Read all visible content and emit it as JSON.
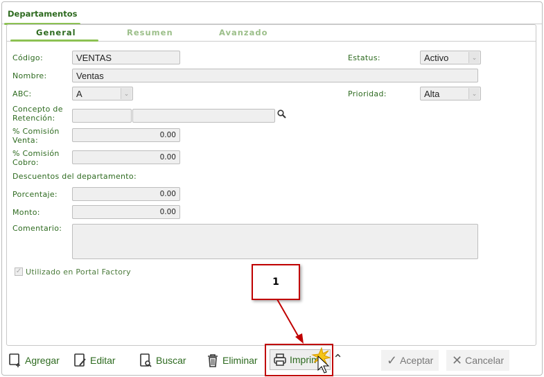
{
  "window": {
    "title": "Departamentos"
  },
  "tabs": [
    {
      "label": "General",
      "active": true
    },
    {
      "label": "Resumen"
    },
    {
      "label": "Avanzado"
    }
  ],
  "form": {
    "codigo": {
      "label": "Código:",
      "value": "VENTAS"
    },
    "estatus": {
      "label": "Estatus:",
      "value": "Activo"
    },
    "nombre": {
      "label": "Nombre:",
      "value": "Ventas"
    },
    "abc": {
      "label": "ABC:",
      "value": "A"
    },
    "prioridad": {
      "label": "Prioridad:",
      "value": "Alta"
    },
    "concepto": {
      "label1": "Concepto de",
      "label2": "Retención:",
      "value1": "",
      "value2": ""
    },
    "comision_venta": {
      "label1": "% Comisión",
      "label2": "Venta:",
      "value": "0.00"
    },
    "comision_cobro": {
      "label1": "% Comisión",
      "label2": "Cobro:",
      "value": "0.00"
    },
    "descuentos_heading": "Descuentos del departamento:",
    "porcentaje": {
      "label": "Porcentaje:",
      "value": "0.00"
    },
    "monto": {
      "label": "Monto:",
      "value": "0.00"
    },
    "comentario": {
      "label": "Comentario:",
      "value": ""
    },
    "portal": {
      "label": "Utilizado en Portal Factory",
      "checked": true
    }
  },
  "toolbar": {
    "agregar": "Agregar",
    "editar": "Editar",
    "buscar": "Buscar",
    "eliminar": "Eliminar",
    "imprimir": "Imprimir",
    "aceptar": "Aceptar",
    "cancelar": "Cancelar"
  },
  "callout": {
    "number": "1"
  },
  "colors": {
    "accent": "#8cc152",
    "text": "#2d6a1f",
    "highlight": "#c00000"
  }
}
